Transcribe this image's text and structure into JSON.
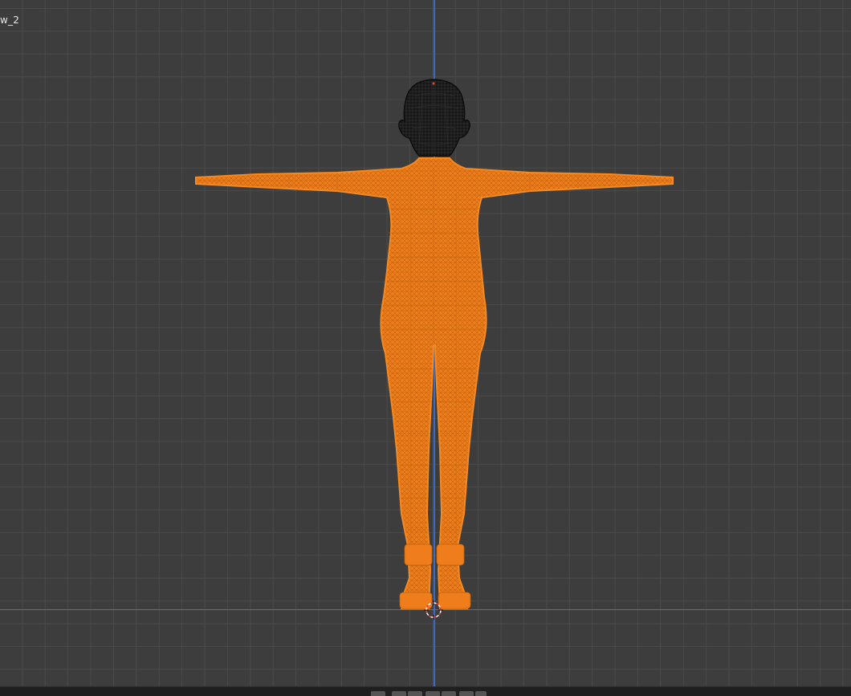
{
  "viewport": {
    "view_label": "w_2",
    "background_color": "#3d3d3d",
    "grid_color": "#4a4a4a",
    "axis_x_color": "#c0474d",
    "axis_z_color": "#3f6fd0"
  },
  "model": {
    "selection_color": "#f07d1c",
    "wire_color": "#a85500",
    "head_color": "#1b1b1b"
  },
  "icons": {
    "cursor": "3d-cursor-icon"
  },
  "bottom_bar": {
    "buttons": [
      "frame-start-button",
      "jump-back-button",
      "play-reverse-button",
      "play-button",
      "jump-forward-button",
      "frame-end-button"
    ]
  }
}
